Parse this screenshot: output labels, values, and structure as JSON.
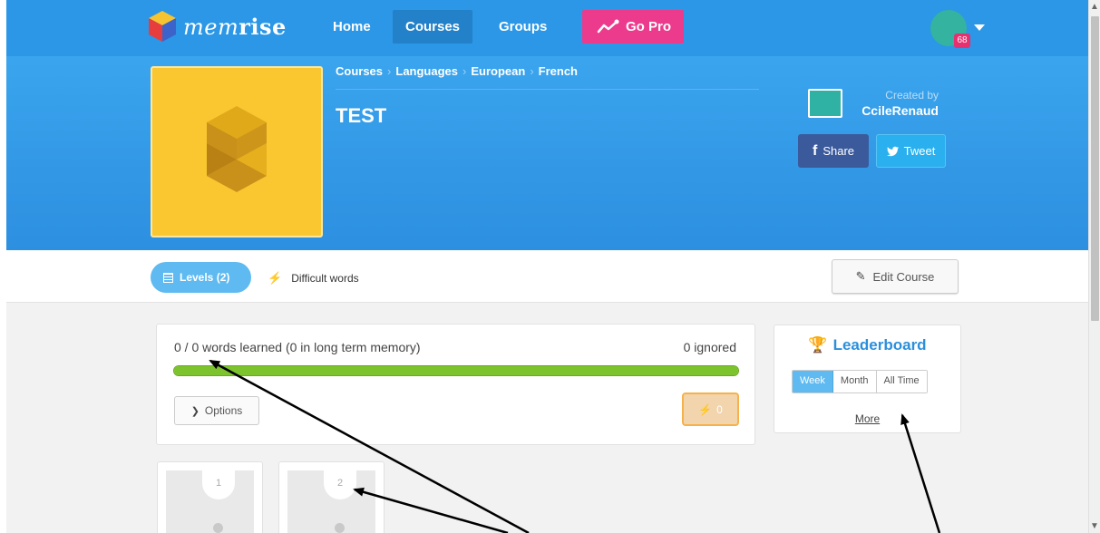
{
  "nav": {
    "logo_text_light": "mem",
    "logo_text_bold": "rise",
    "home": "Home",
    "courses": "Courses",
    "groups": "Groups",
    "go_pro": "Go Pro",
    "notification_count": "68"
  },
  "course": {
    "breadcrumbs": [
      "Courses",
      "Languages",
      "European",
      "French"
    ],
    "title": "TEST",
    "created_by_label": "Created by",
    "creator": "CcileRenaud",
    "share": "Share",
    "tweet": "Tweet"
  },
  "tabs": {
    "levels": "Levels (2)",
    "difficult": "Difficult words",
    "edit_course": "Edit Course"
  },
  "progress": {
    "words_learned": "0 / 0 words learned (0 in long term memory)",
    "ignored": "0 ignored",
    "fill_fraction": 1.0,
    "options": "Options",
    "speed_count": "0"
  },
  "leaderboard": {
    "title": "Leaderboard",
    "periods": [
      "Week",
      "Month",
      "All Time"
    ],
    "active_period": "Week",
    "more": "More"
  },
  "levels": [
    {
      "number": "1"
    },
    {
      "number": "2"
    }
  ],
  "colors": {
    "nav_blue": "#2b97e6",
    "accent_pink": "#ec3a8c",
    "course_yellow": "#fac731",
    "progress_green": "#7cc32e",
    "link_blue": "#2b8fdc"
  }
}
